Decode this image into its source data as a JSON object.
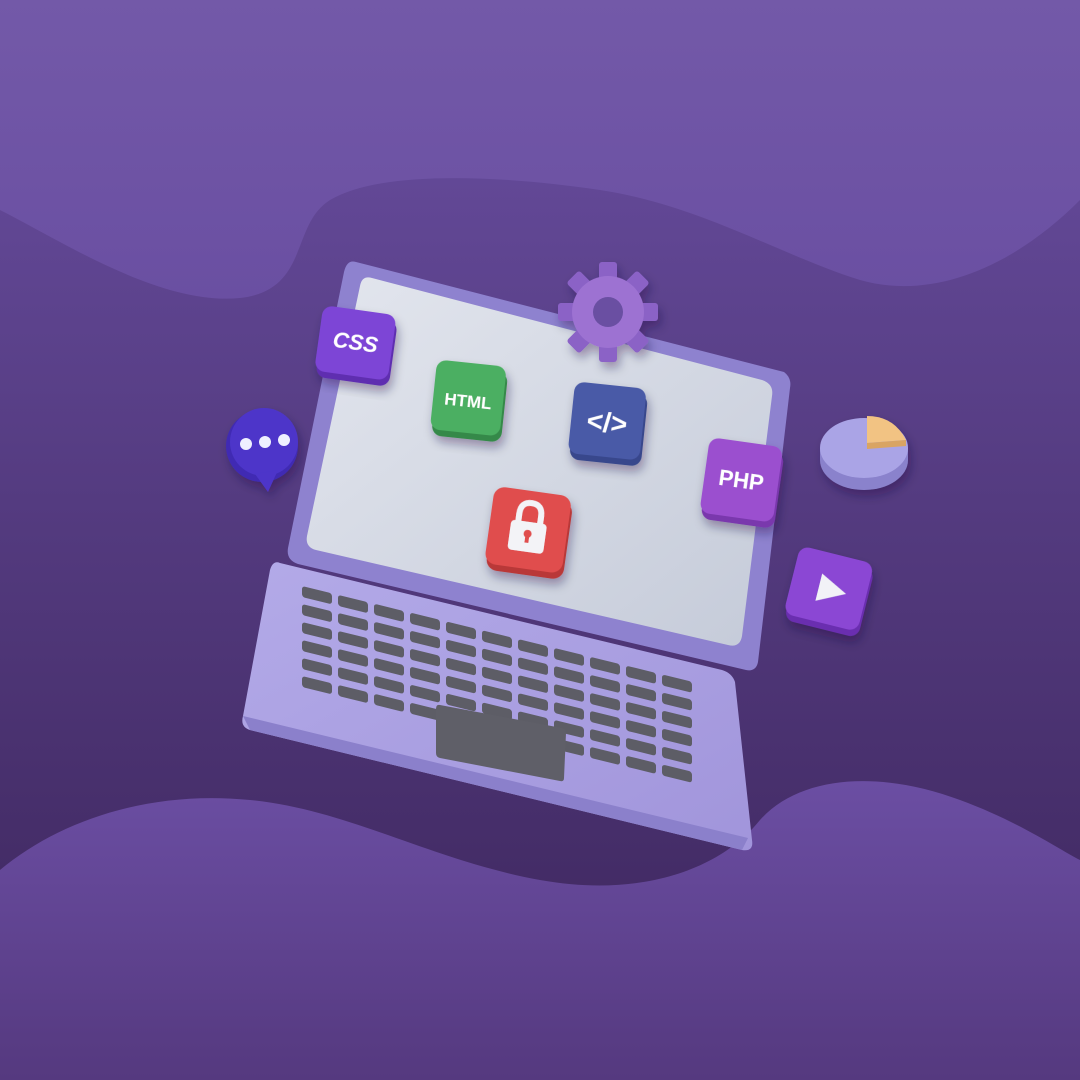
{
  "scene": {
    "colors": {
      "bg_top": "#6a4fa2",
      "bg_bottom": "#3b2459",
      "wave": "#6f52a6",
      "laptop": "#a79de0",
      "laptop_edge": "#8e82cf",
      "screen": "#d5dbe6",
      "key": "#5d5d66",
      "trackpad": "#5f5f68"
    },
    "badges": {
      "css": {
        "label": "CSS",
        "color": "#7d44d6",
        "icon": "css-badge"
      },
      "html": {
        "label": "HTML",
        "color": "#4caf62",
        "icon": "html-badge"
      },
      "code": {
        "label": "</>",
        "color": "#4a5aa7",
        "icon": "code-icon"
      },
      "php": {
        "label": "PHP",
        "color": "#9b50cf",
        "icon": "php-badge"
      },
      "lock": {
        "color": "#e04d4d",
        "icon": "lock-icon"
      },
      "chat": {
        "color": "#4d35c9",
        "icon": "chat-bubble-icon"
      },
      "gear": {
        "color": "#9d72d2",
        "icon": "gear-icon"
      },
      "pie": {
        "color": "#aaa4e6",
        "slice_color": "#f2c383",
        "icon": "pie-chart-icon"
      },
      "play": {
        "color": "#8b46d4",
        "icon": "play-icon"
      }
    }
  }
}
